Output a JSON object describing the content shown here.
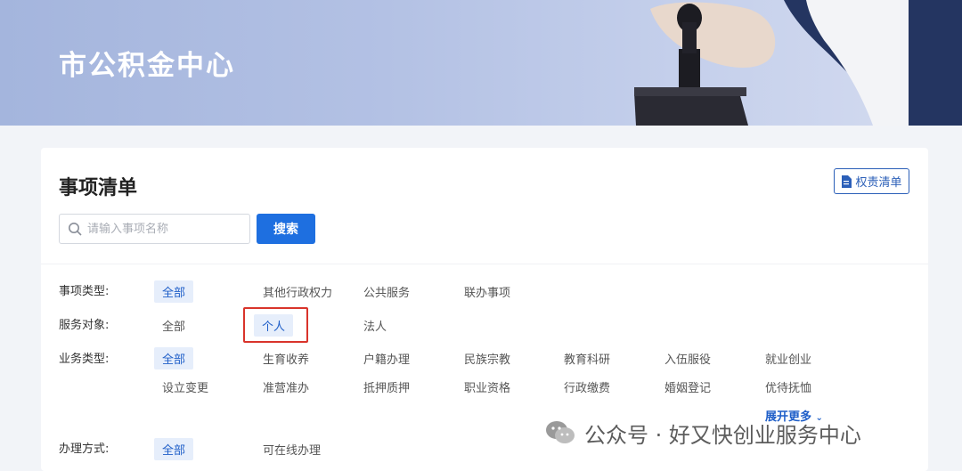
{
  "banner": {
    "title": "市公积金中心"
  },
  "card": {
    "title": "事项清单",
    "power_list_label": "权责清单",
    "search": {
      "placeholder": "请输入事项名称",
      "value": "",
      "button_label": "搜索"
    }
  },
  "filters": {
    "item_type": {
      "label": "事项类型:",
      "options": [
        "全部",
        "其他行政权力",
        "公共服务",
        "联办事项"
      ],
      "selected": "全部"
    },
    "service_target": {
      "label": "服务对象:",
      "options": [
        "全部",
        "个人",
        "法人"
      ],
      "selected": "个人"
    },
    "business_type": {
      "label": "业务类型:",
      "options": [
        "全部",
        "生育收养",
        "户籍办理",
        "民族宗教",
        "教育科研",
        "入伍服役",
        "就业创业",
        "设立变更",
        "准营准办",
        "抵押质押",
        "职业资格",
        "行政缴费",
        "婚姻登记",
        "优待抚恤"
      ],
      "selected": "全部",
      "more_label": "展开更多"
    },
    "handling_method": {
      "label": "办理方式:",
      "options": [
        "全部",
        "可在线办理"
      ],
      "selected": "全部"
    }
  },
  "watermark": {
    "text": "公众号 · 好又快创业服务中心"
  },
  "colors": {
    "accent": "#1e6fe0",
    "highlight": "#d9342b",
    "active_bg": "#e6eefb"
  }
}
